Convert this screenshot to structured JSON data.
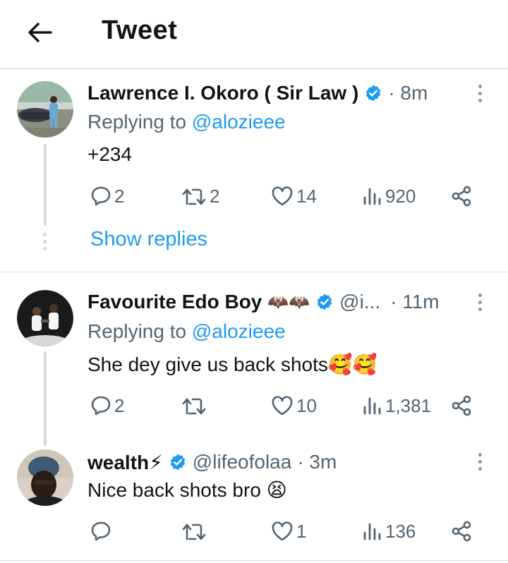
{
  "header": {
    "title": "Tweet"
  },
  "tweets": [
    {
      "name": "Lawrence I. Okoro ( Sir Law )",
      "handle": "",
      "time": "· 8m",
      "reply_prefix": "Replying to",
      "reply_to": "@alozieee",
      "text": "+234",
      "replies": "2",
      "retweets": "2",
      "likes": "14",
      "views": "920"
    },
    {
      "name": "Favourite Edo Boy",
      "name_emoji": "🦇🦇",
      "handle": "@i...",
      "time": "· 11m",
      "reply_prefix": "Replying to",
      "reply_to": "@alozieee",
      "text": "She dey give us back shots🥰🥰",
      "replies": "2",
      "retweets": "",
      "likes": "10",
      "views": "1,381"
    },
    {
      "name": "wealth⚡",
      "handle": "@lifeofolaa",
      "time": "· 3m",
      "text": "Nice back shots bro 😫",
      "replies": "",
      "retweets": "",
      "likes": "1",
      "views": "136"
    }
  ],
  "show_replies": "Show replies",
  "icons": {
    "back": "arrow-left-icon",
    "verified": "verified-badge-icon",
    "reply": "reply-bubble-icon",
    "retweet": "retweet-icon",
    "like": "heart-icon",
    "views": "views-bars-icon",
    "share": "share-icon",
    "more": "more-vertical-icon"
  },
  "colors": {
    "accent": "#1d9bf0",
    "muted": "#536471",
    "text": "#0f1419",
    "line": "#cfd9de"
  }
}
